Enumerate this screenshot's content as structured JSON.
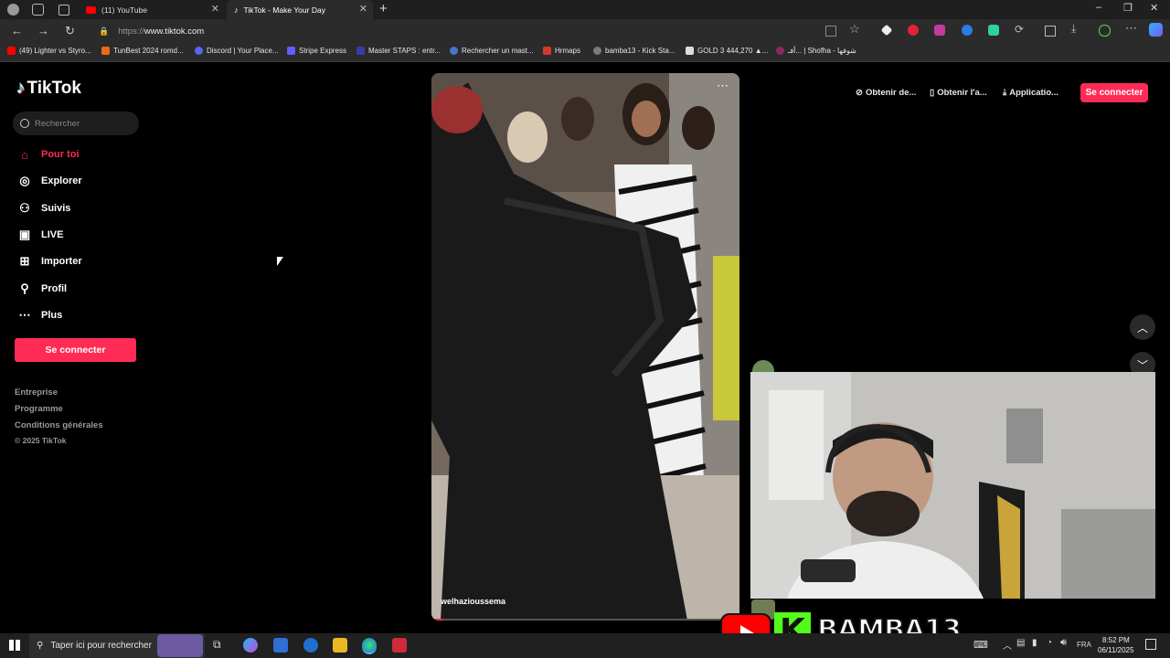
{
  "browser": {
    "tabs": [
      {
        "label": "(11) YouTube"
      },
      {
        "label": "TikTok - Make Your Day"
      }
    ],
    "url_prefix": "https://",
    "url_domain": "www.tiktok.com",
    "bookmarks": [
      "(49) Lighter vs Styro...",
      "TunBest 2024 romd...",
      "Discord | Your Place...",
      "Stripe Express",
      "Master STAPS : entr...",
      "Rechercher un mast...",
      "Hrmaps",
      "bamba13 - Kick Sta...",
      "GOLD 3 444,270 ▲...",
      "أفـ... | Shofha - شوفها"
    ]
  },
  "tiktok": {
    "logo": "TikTok",
    "search_placeholder": "Rechercher",
    "nav": [
      {
        "label": "Pour toi",
        "icon": "home-icon"
      },
      {
        "label": "Explorer",
        "icon": "compass-icon"
      },
      {
        "label": "Suivis",
        "icon": "following-icon"
      },
      {
        "label": "LIVE",
        "icon": "live-icon"
      },
      {
        "label": "Importer",
        "icon": "upload-icon"
      },
      {
        "label": "Profil",
        "icon": "profile-icon"
      },
      {
        "label": "Plus",
        "icon": "more-icon"
      }
    ],
    "login_label": "Se connecter",
    "footer": [
      "Entreprise",
      "Programme",
      "Conditions générales",
      "© 2025 TikTok"
    ],
    "top_actions": [
      "Obtenir de...",
      "Obtenir l'a...",
      "Applicatio..."
    ],
    "video_username": "welhazioussema",
    "accent": "#fe2c55"
  },
  "stream_overlay": {
    "channel": "BAMBA13"
  },
  "taskbar": {
    "search_placeholder": "Taper ici pour rechercher",
    "language": "FRA",
    "time": "8:52 PM",
    "date": "06/11/2025"
  }
}
